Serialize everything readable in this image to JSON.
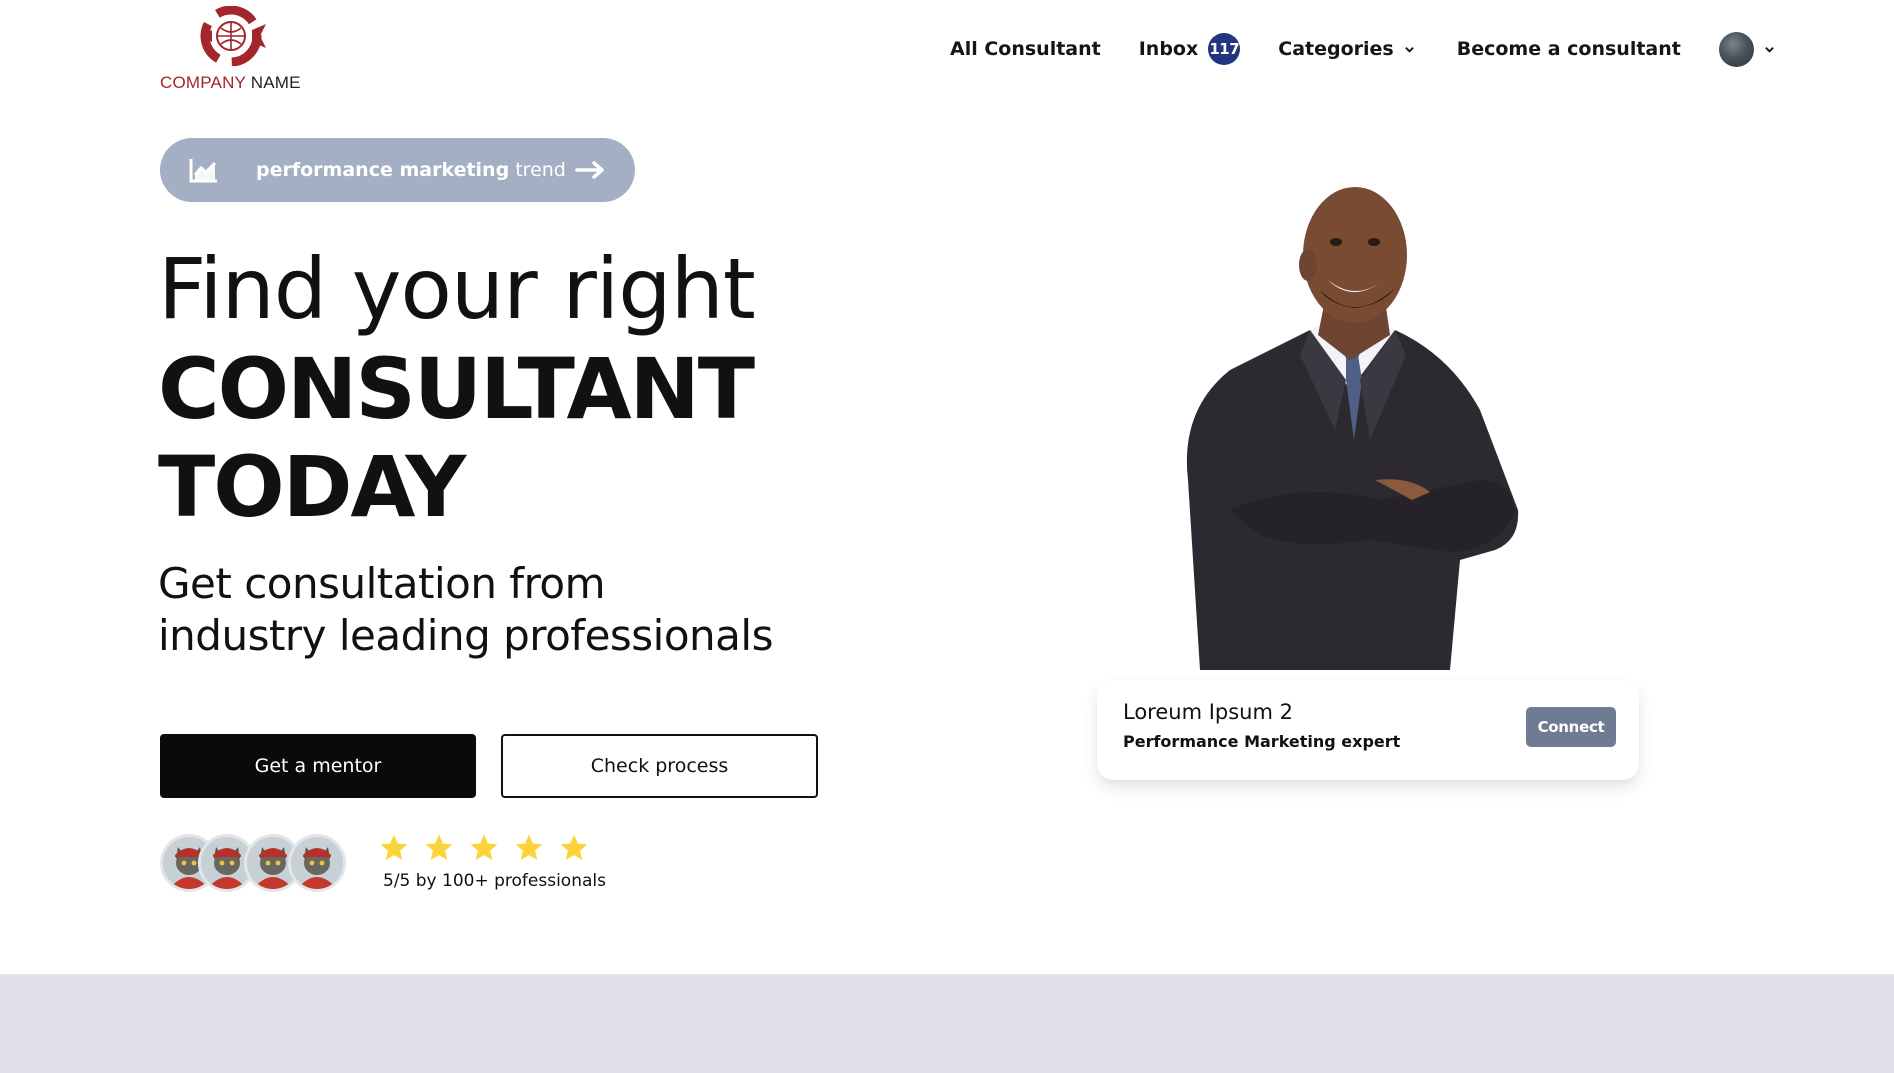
{
  "header": {
    "logo_text_part1": "COMPANY",
    "logo_text_part2": " NAME",
    "nav": {
      "all_consultant": "All Consultant",
      "inbox": "Inbox",
      "inbox_count": "117",
      "categories": "Categories",
      "become_consultant": "Become a consultant"
    }
  },
  "hero": {
    "pill": {
      "bold": "performance marketing",
      "light": " trend",
      "icon": "trend-chart-icon",
      "arrow_icon": "arrow-right-icon"
    },
    "headline_line1": "Find your right",
    "headline_line2": "CONSULTANT",
    "headline_line3": "TODAY",
    "subtitle_line1": "Get consultation from",
    "subtitle_line2": "industry leading professionals",
    "primary_button": "Get a mentor",
    "secondary_button": "Check process",
    "rating_stars": 5,
    "rating_text": "5/5 by 100+ professionals"
  },
  "consultant_card": {
    "name": "Loreum Ipsum 2",
    "role": "Performance Marketing expert",
    "connect_button": "Connect"
  },
  "colors": {
    "brand_red": "#a3262a",
    "badge": "#24357f",
    "pill_bg": "#a5afc3",
    "connect_bg": "#6f7b92",
    "star": "#fbd33a",
    "footer_band": "#e3dfec"
  }
}
